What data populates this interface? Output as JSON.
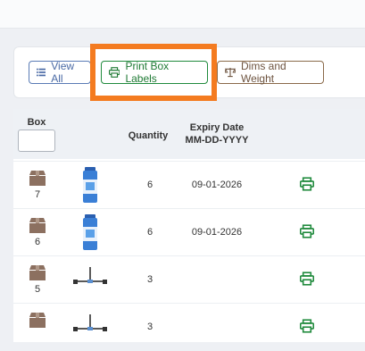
{
  "toolbar": {
    "view_all_label": "View All",
    "print_box_labels_label": "Print Box Labels",
    "dims_weight_label": "Dims and Weight"
  },
  "table": {
    "headers": {
      "box": "Box",
      "quantity": "Quantity",
      "expiry_line1": "Expiry Date",
      "expiry_line2": "MM-DD-YYYY"
    },
    "rows": [
      {
        "box": "7",
        "product_image": "spray-can",
        "quantity": "6",
        "expiry": "09-01-2026"
      },
      {
        "box": "6",
        "product_image": "spray-can",
        "quantity": "6",
        "expiry": "09-01-2026"
      },
      {
        "box": "5",
        "product_image": "stand-tool",
        "quantity": "3",
        "expiry": ""
      },
      {
        "box": "",
        "product_image": "stand-tool",
        "quantity": "3",
        "expiry": ""
      }
    ]
  },
  "colors": {
    "highlight": "#f47b20",
    "print_green": "#1f8a3c",
    "box_brown": "#8c7060"
  }
}
